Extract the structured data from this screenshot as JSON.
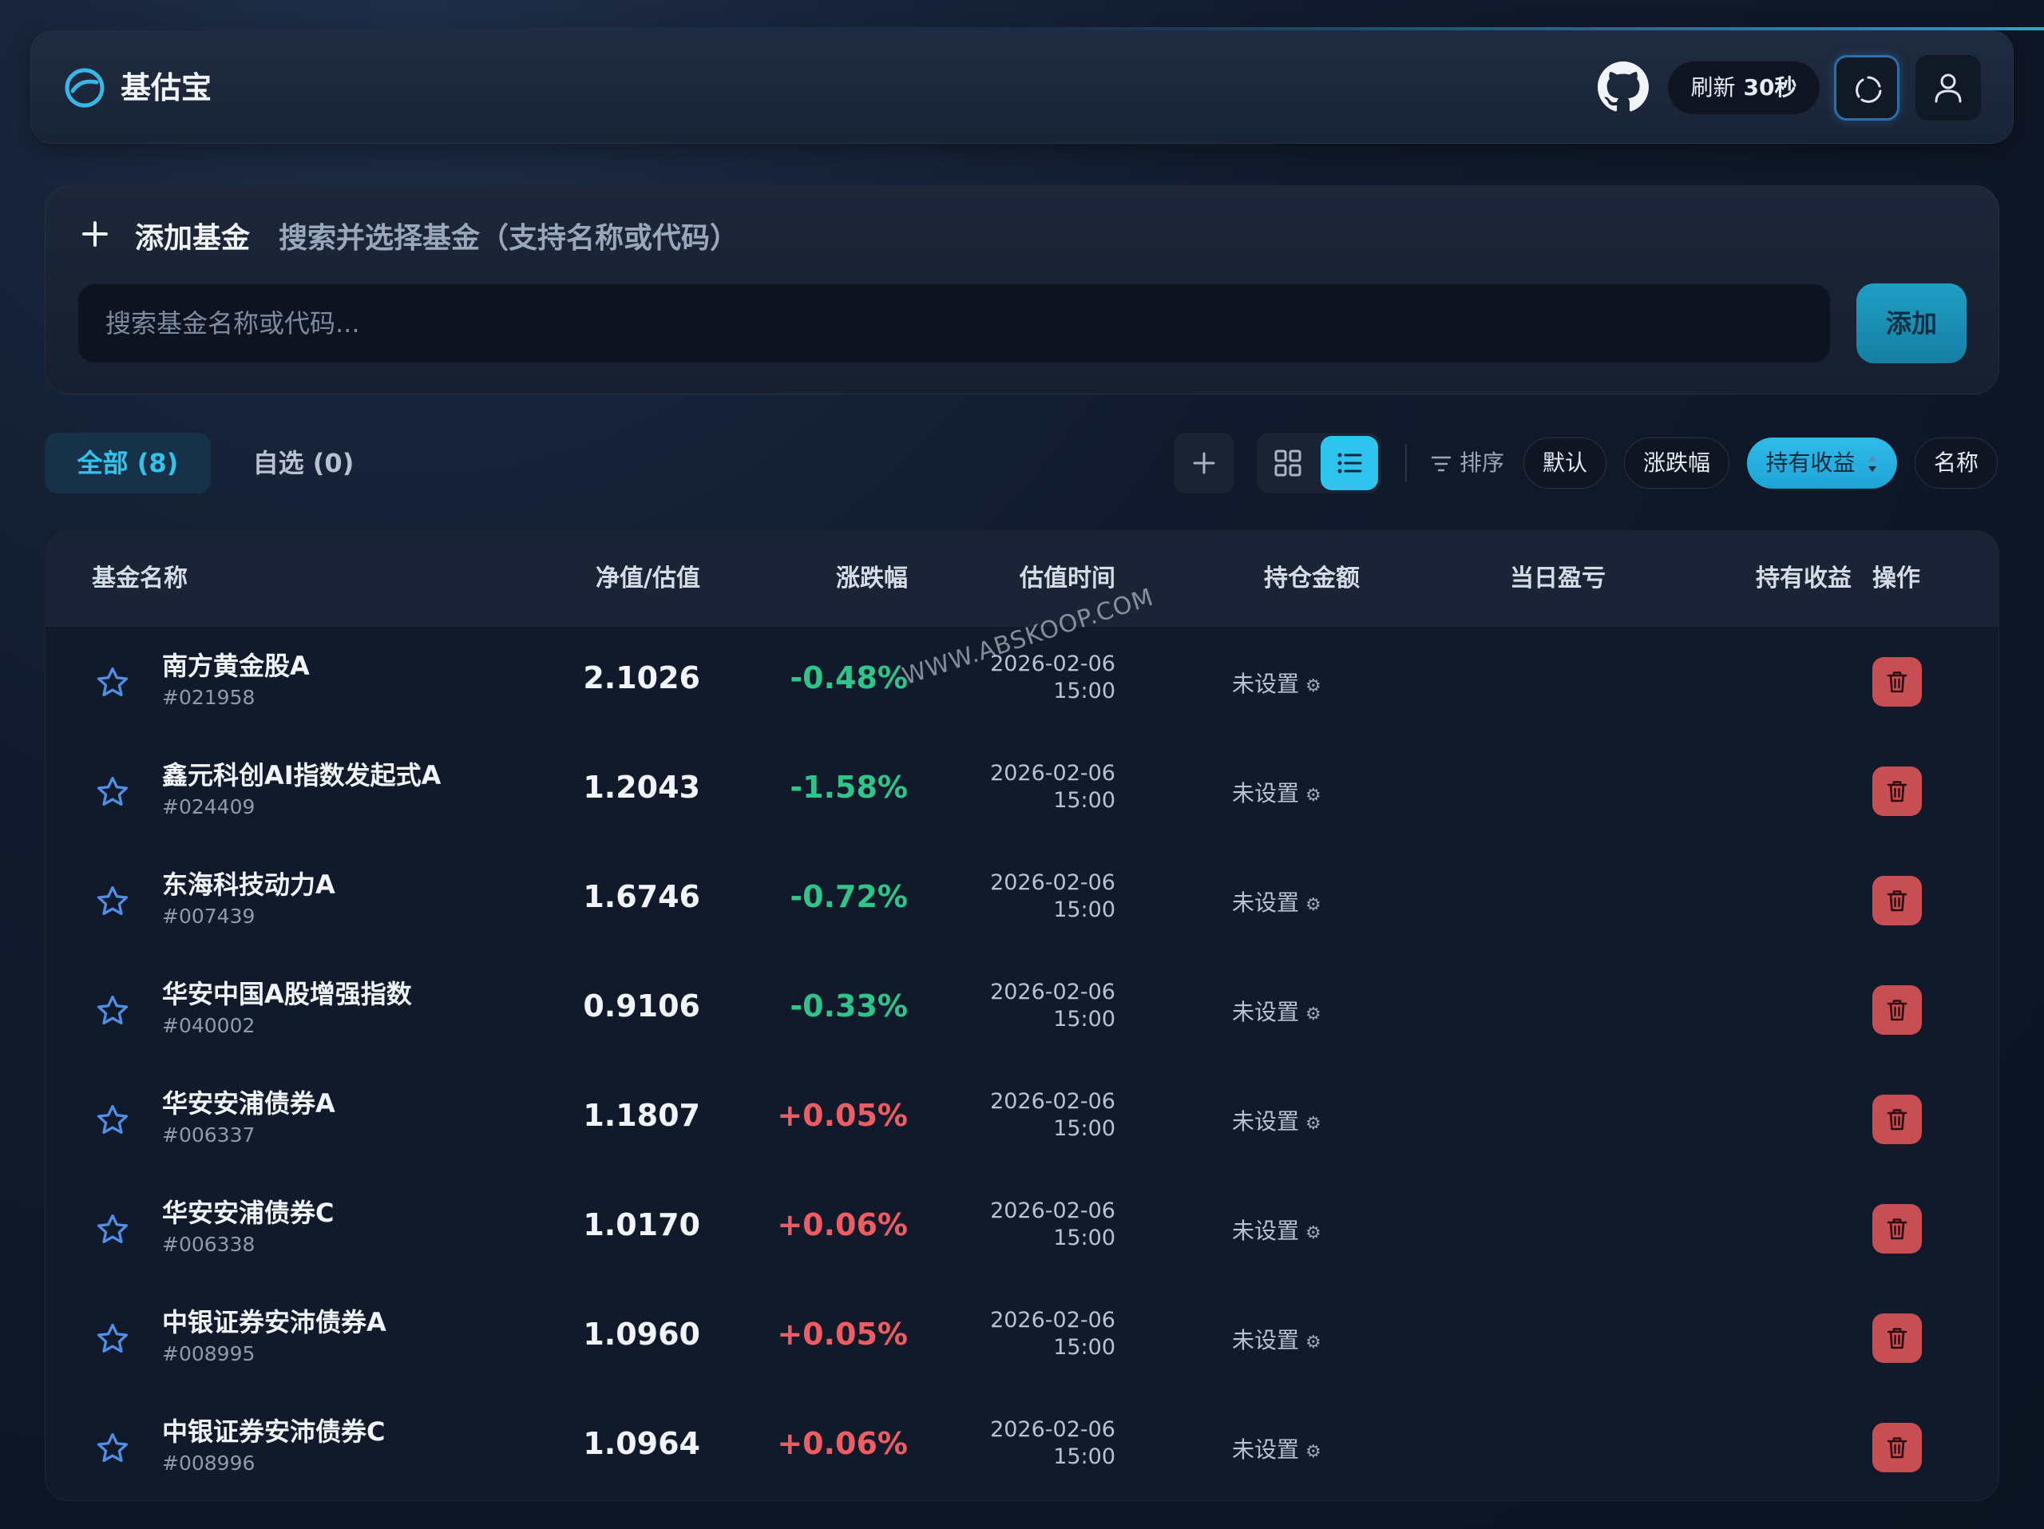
{
  "app": {
    "title": "基估宝"
  },
  "header": {
    "refresh_label": "刷新",
    "refresh_interval": "30秒"
  },
  "add_panel": {
    "title": "添加基金",
    "subtitle": "搜索并选择基金（支持名称或代码）",
    "search_placeholder": "搜索基金名称或代码...",
    "search_value": "",
    "add_button": "添加"
  },
  "tabs": [
    {
      "label": "全部 (8)",
      "active": true
    },
    {
      "label": "自选 (0)",
      "active": false
    }
  ],
  "sort": {
    "label": "排序",
    "options": [
      {
        "label": "默认",
        "active": false
      },
      {
        "label": "涨跌幅",
        "active": false
      },
      {
        "label": "持有收益",
        "active": true
      },
      {
        "label": "名称",
        "active": false
      }
    ]
  },
  "table": {
    "columns": [
      "基金名称",
      "净值/估值",
      "涨跌幅",
      "估值时间",
      "持仓金额",
      "当日盈亏",
      "持有收益",
      "操作"
    ],
    "rows": [
      {
        "name": "南方黄金股A",
        "code": "#021958",
        "nav": "2.1026",
        "change": "-0.48%",
        "direction": "down",
        "date": "2026-02-06",
        "time": "15:00",
        "holding": "未设置",
        "daily_pl": "",
        "total_pl": ""
      },
      {
        "name": "鑫元科创AI指数发起式A",
        "code": "#024409",
        "nav": "1.2043",
        "change": "-1.58%",
        "direction": "down",
        "date": "2026-02-06",
        "time": "15:00",
        "holding": "未设置",
        "daily_pl": "",
        "total_pl": ""
      },
      {
        "name": "东海科技动力A",
        "code": "#007439",
        "nav": "1.6746",
        "change": "-0.72%",
        "direction": "down",
        "date": "2026-02-06",
        "time": "15:00",
        "holding": "未设置",
        "daily_pl": "",
        "total_pl": ""
      },
      {
        "name": "华安中国A股增强指数",
        "code": "#040002",
        "nav": "0.9106",
        "change": "-0.33%",
        "direction": "down",
        "date": "2026-02-06",
        "time": "15:00",
        "holding": "未设置",
        "daily_pl": "",
        "total_pl": ""
      },
      {
        "name": "华安安浦债券A",
        "code": "#006337",
        "nav": "1.1807",
        "change": "+0.05%",
        "direction": "up",
        "date": "2026-02-06",
        "time": "15:00",
        "holding": "未设置",
        "daily_pl": "",
        "total_pl": ""
      },
      {
        "name": "华安安浦债券C",
        "code": "#006338",
        "nav": "1.0170",
        "change": "+0.06%",
        "direction": "up",
        "date": "2026-02-06",
        "time": "15:00",
        "holding": "未设置",
        "daily_pl": "",
        "total_pl": ""
      },
      {
        "name": "中银证券安沛债券A",
        "code": "#008995",
        "nav": "1.0960",
        "change": "+0.05%",
        "direction": "up",
        "date": "2026-02-06",
        "time": "15:00",
        "holding": "未设置",
        "daily_pl": "",
        "total_pl": ""
      },
      {
        "name": "中银证券安沛债券C",
        "code": "#008996",
        "nav": "1.0964",
        "change": "+0.06%",
        "direction": "up",
        "date": "2026-02-06",
        "time": "15:00",
        "holding": "未设置",
        "daily_pl": "",
        "total_pl": ""
      }
    ]
  },
  "watermark": "WWW.ABSKOOP.COM",
  "colors": {
    "accent": "#2ec4ee",
    "down": "#2fc48a",
    "up": "#ef5d62",
    "delete": "#c74e52",
    "star": "#4f8fe8"
  },
  "icons": {
    "logo": "logo-icon",
    "github": "github-icon",
    "refresh": "refresh-icon",
    "user": "user-icon",
    "plus": "plus-icon",
    "grid": "grid-icon",
    "list": "list-icon",
    "filter": "filter-icon",
    "star": "star-icon",
    "gear": "gear-icon",
    "trash": "trash-icon"
  }
}
